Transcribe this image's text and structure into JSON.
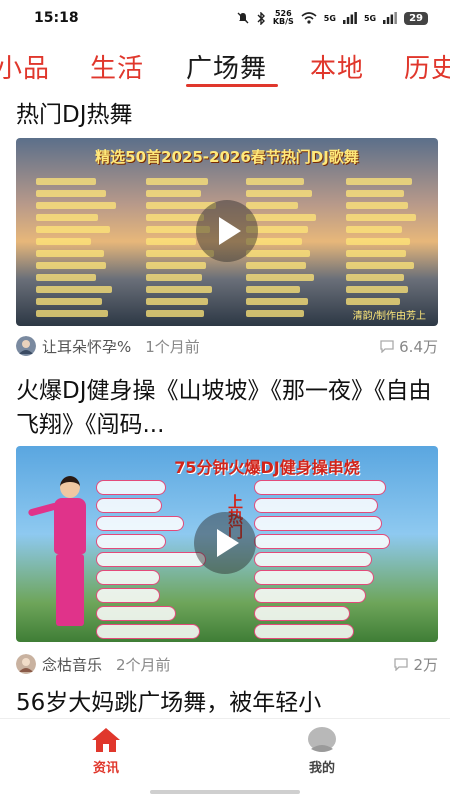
{
  "status_bar": {
    "time": "15:18",
    "network_speed_value": "526",
    "network_speed_unit": "KB/S",
    "signal_1": "5G",
    "signal_2": "5G",
    "battery": "29",
    "icons": [
      "bell-off-icon",
      "bluetooth-icon",
      "wifi-icon",
      "signal-icon"
    ]
  },
  "tabs": [
    {
      "label": "小品",
      "active": false
    },
    {
      "label": "生活",
      "active": false
    },
    {
      "label": "广场舞",
      "active": true
    },
    {
      "label": "本地",
      "active": false
    },
    {
      "label": "历史",
      "active": false
    }
  ],
  "feed": [
    {
      "title": "热门DJ热舞",
      "thumbnail_title": "精选50首2025-2026春节热门DJ歌舞",
      "thumbnail_credit": "清韵/制作由芳上",
      "author": "让耳朵怀孕%",
      "time_ago": "1个月前",
      "comments": "6.4万"
    },
    {
      "title": "火爆DJ健身操《山坡坡》《那一夜》《自由飞翔》《闯码...",
      "thumbnail_title": "75分钟火爆DJ健身操串烧",
      "thumbnail_side_text": "上热门",
      "author": "念枯音乐",
      "time_ago": "2个月前",
      "comments": "2万"
    },
    {
      "title": "56岁大妈跳广场舞，被年轻小"
    }
  ],
  "bottom_nav": [
    {
      "label": "资讯",
      "icon": "home-icon",
      "active": true
    },
    {
      "label": "我的",
      "icon": "profile-icon",
      "active": false
    }
  ],
  "colors": {
    "accent": "#e0372c",
    "muted": "#888888"
  }
}
